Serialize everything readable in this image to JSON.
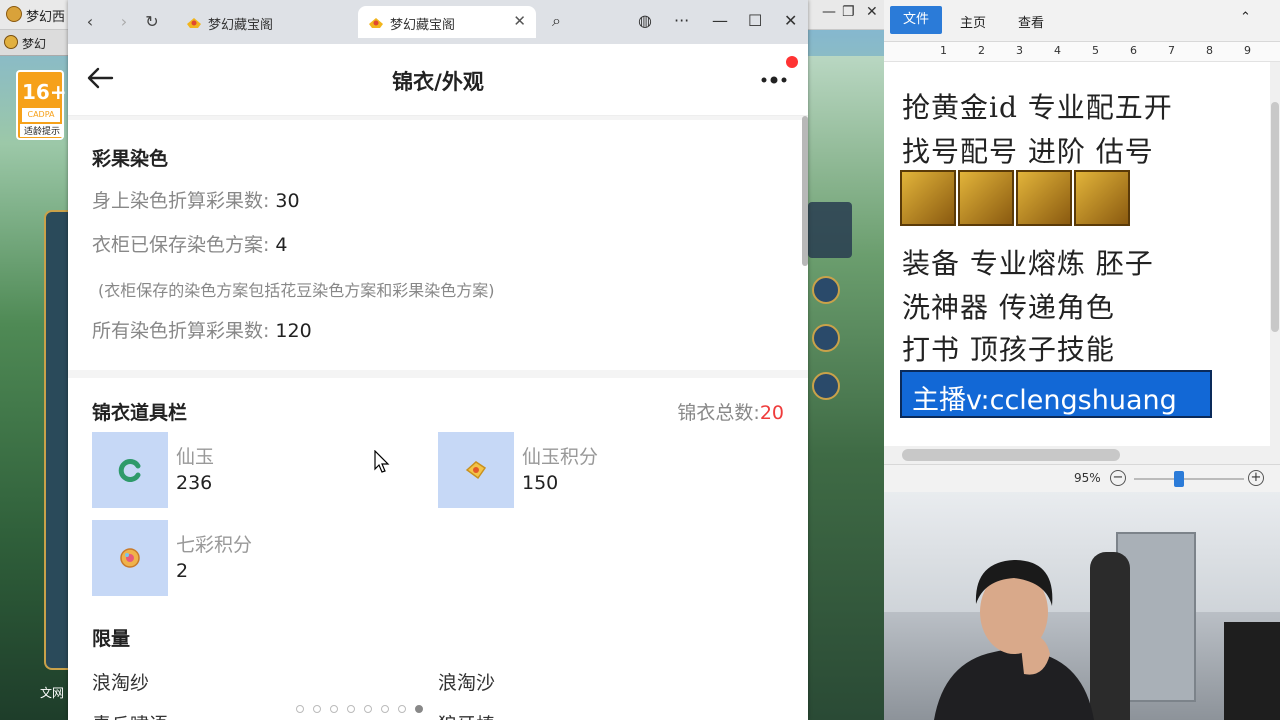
{
  "game": {
    "title": "梦幻西",
    "tab2_title": "梦幻",
    "age_badge": {
      "number": "16+",
      "cadpa": "CADPA",
      "tip": "适龄提示"
    },
    "bottom_label": "文网",
    "controls": {
      "minimize": "—",
      "restore": "❐",
      "close": "✕"
    }
  },
  "browser": {
    "tabs": [
      {
        "label": "梦幻藏宝阁",
        "active": false
      },
      {
        "label": "梦幻藏宝阁",
        "active": true
      }
    ],
    "window_controls": {
      "minimize": "—",
      "maximize": "☐",
      "close": "✕"
    }
  },
  "page": {
    "title": "锦衣/外观",
    "dye": {
      "title": "彩果染色",
      "rows": [
        {
          "label": "身上染色折算彩果数:",
          "value": "30"
        },
        {
          "label": "衣柜已保存染色方案:",
          "value": "4"
        }
      ],
      "note": "(衣柜保存的染色方案包括花豆染色方案和彩果染色方案)",
      "total": {
        "label": "所有染色折算彩果数:",
        "value": "120"
      }
    },
    "props": {
      "title": "锦衣道具栏",
      "count_label": "锦衣总数:",
      "count_value": "20",
      "items": [
        {
          "name": "仙玉",
          "value": "236",
          "icon": "jade-icon"
        },
        {
          "name": "仙玉积分",
          "value": "150",
          "icon": "jade-points-icon"
        },
        {
          "name": "七彩积分",
          "value": "2",
          "icon": "rainbow-points-icon"
        }
      ]
    },
    "limited": {
      "title": "限量",
      "items": [
        "浪淘纱",
        "浪淘沙",
        "青丘啸语",
        "狼牙棒"
      ]
    },
    "pager": {
      "count": 8,
      "active_index": 7
    }
  },
  "doc": {
    "ribbon_tabs": [
      "文件",
      "主页",
      "查看"
    ],
    "ruler_marks": [
      "1",
      "2",
      "3",
      "4",
      "5",
      "6",
      "7",
      "8",
      "9"
    ],
    "lines": [
      "抢黄金id 专业配五开",
      "找号配号 进阶 估号",
      "装备 专业熔炼 胚子",
      "洗神器 传递角色",
      "打书 顶孩子技能"
    ],
    "highlight": "主播v:cclengshuang",
    "zoom": "95%"
  },
  "colors": {
    "accent_red": "#ef3b3b",
    "wps_blue": "#2b7bd8",
    "thumb_blue": "#c6d8f6",
    "highlight_blue": "#1268d6"
  }
}
